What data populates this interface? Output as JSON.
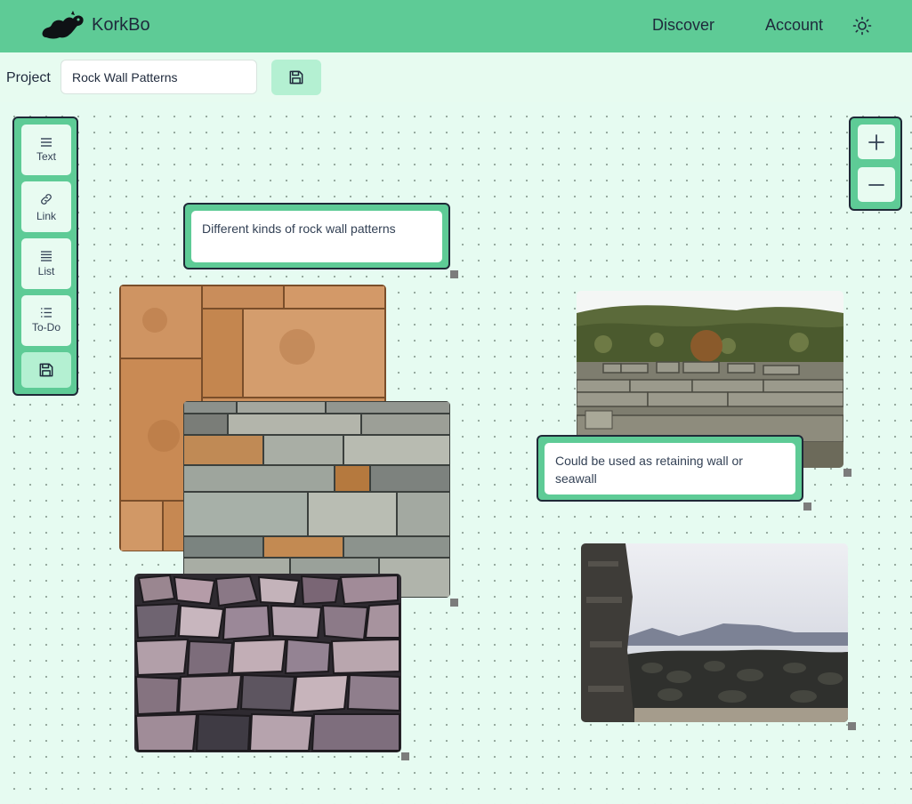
{
  "app": {
    "brand": "KorkBo"
  },
  "nav": {
    "discover": "Discover",
    "account": "Account"
  },
  "project": {
    "label": "Project",
    "name": "Rock Wall Patterns"
  },
  "toolbar": {
    "text": "Text",
    "link": "Link",
    "list": "List",
    "todo": "To-Do"
  },
  "notes": {
    "note1": "Different kinds of rock wall patterns",
    "note2": "Could be used as retaining wall or seawall"
  },
  "colors": {
    "accent": "#5ecb96",
    "accent_light": "#b4f0d2",
    "canvas_bg": "#e6fbf1",
    "border": "#1f2937"
  },
  "icons": {
    "logo": "squirrel-logo-icon",
    "theme": "sun-icon",
    "save": "floppy-disk-icon",
    "zoom_in": "plus-icon",
    "zoom_out": "minus-icon"
  }
}
